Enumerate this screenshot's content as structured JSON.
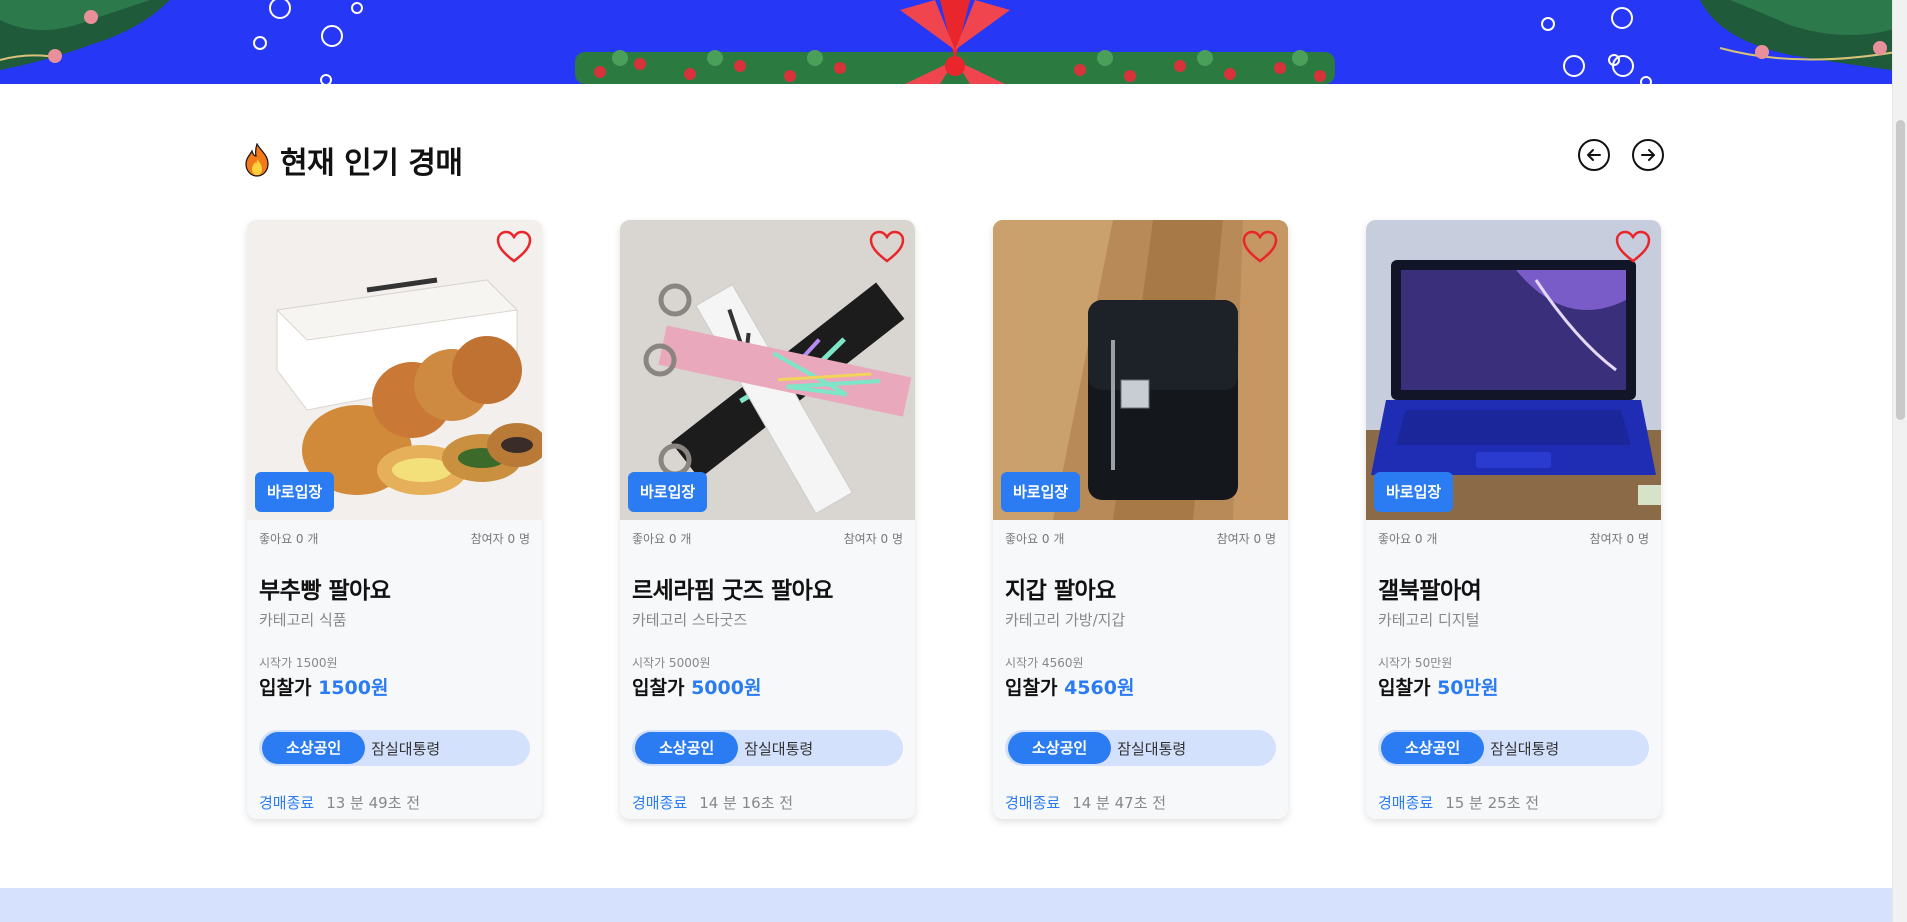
{
  "section": {
    "title": "현재 인기 경매"
  },
  "colors": {
    "accent": "#2b7cf2",
    "banner": "#2637f5",
    "heart": "#e8262b",
    "seller_bg": "#d3e1fd"
  },
  "navigation": {
    "prev_icon": "arrow-left-icon",
    "next_icon": "arrow-right-icon"
  },
  "cards": [
    {
      "enter": "바로입장",
      "likes": "좋아요 0 개",
      "participants": "참여자 0 명",
      "title": "부추빵 팔아요",
      "category": "카테고리 식품",
      "start_price": "시작가 1500원",
      "bid_label": "입찰가",
      "bid_amount": "1500원",
      "seller_type": "소상공인",
      "location": "잠실대통령",
      "ending_label": "경매종료",
      "ending_time": "13 분 49초 전"
    },
    {
      "enter": "바로입장",
      "likes": "좋아요 0 개",
      "participants": "참여자 0 명",
      "title": "르세라핌 굿즈 팔아요",
      "category": "카테고리 스타굿즈",
      "start_price": "시작가 5000원",
      "bid_label": "입찰가",
      "bid_amount": "5000원",
      "seller_type": "소상공인",
      "location": "잠실대통령",
      "ending_label": "경매종료",
      "ending_time": "14 분 16초 전"
    },
    {
      "enter": "바로입장",
      "likes": "좋아요 0 개",
      "participants": "참여자 0 명",
      "title": "지갑 팔아요",
      "category": "카테고리 가방/지갑",
      "start_price": "시작가 4560원",
      "bid_label": "입찰가",
      "bid_amount": "4560원",
      "seller_type": "소상공인",
      "location": "잠실대통령",
      "ending_label": "경매종료",
      "ending_time": "14 분 47초 전"
    },
    {
      "enter": "바로입장",
      "likes": "좋아요 0 개",
      "participants": "참여자 0 명",
      "title": "갤북팔아여",
      "category": "카테고리 디지털",
      "start_price": "시작가 50만원",
      "bid_label": "입찰가",
      "bid_amount": "50만원",
      "seller_type": "소상공인",
      "location": "잠실대통령",
      "ending_label": "경매종료",
      "ending_time": "15 분 25초 전"
    }
  ]
}
